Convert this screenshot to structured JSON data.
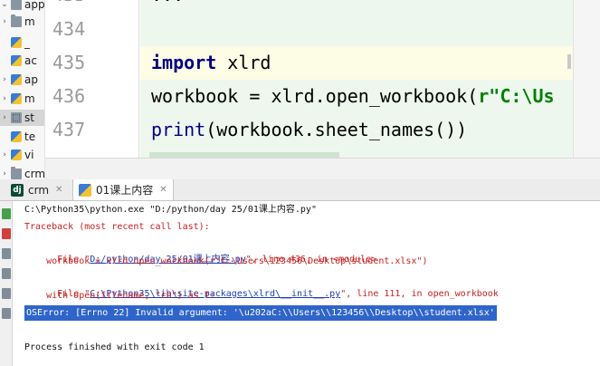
{
  "project_tree": {
    "items": [
      {
        "label": "app0",
        "icon": "folder-icon",
        "expanded": true
      },
      {
        "label": "m",
        "icon": "folder-icon",
        "expanded": false
      },
      {
        "label": "_",
        "icon": "python-file-icon"
      },
      {
        "label": "ac",
        "icon": "python-file-icon"
      },
      {
        "label": "ap",
        "icon": "python-file-icon"
      },
      {
        "label": "m",
        "icon": "python-file-icon"
      },
      {
        "label": "st",
        "icon": "package-icon",
        "selected": true
      },
      {
        "label": "te",
        "icon": "python-file-icon"
      },
      {
        "label": "vi",
        "icon": "python-file-icon"
      },
      {
        "label": "crm",
        "icon": "folder-icon"
      }
    ]
  },
  "editor": {
    "line_numbers": [
      "434",
      "435",
      "436",
      "437"
    ],
    "current_line": "435",
    "lines": [
      {
        "keyword": "import",
        "rest": " xlrd"
      },
      {
        "plain": "workbook = xlrd.open_workbook(",
        "string": "r\"C:\\Us"
      },
      {
        "builtin": "print",
        "rest": "(workbook.sheet_names())"
      }
    ]
  },
  "run_tabs": [
    {
      "label": "crm",
      "icon": "django-icon"
    },
    {
      "label": "01课上内容",
      "icon": "python-file-icon",
      "active": true
    }
  ],
  "console": {
    "command": "C:\\Python35\\python.exe \"D:/python/day 25/01课上内容.py\"",
    "traceback_header": "Traceback (most recent call last):",
    "frame1": {
      "prefix": "  File \"",
      "path": "D:/python/day 25/01课上内容.py",
      "suffix": "\", line 436, in <module>"
    },
    "frame1_code": "    workbook = xlrd.open_workbook(r\"C:\\Users\\123456\\Desktop\\student.xlsx\")",
    "frame2": {
      "prefix": "  File \"",
      "path": "C:\\Python35\\lib\\site-packages\\xlrd\\__init__.py",
      "suffix": "\", line 111, in open_workbook"
    },
    "frame2_code": "    with open(filename, \"rb\") as f:",
    "error": "OSError: [Errno 22] Invalid argument: '\\u202aC:\\\\Users\\\\123456\\\\Desktop\\\\student.xlsx'",
    "exit": "Process finished with exit code 1"
  },
  "colors": {
    "editor_bg": "#eef7ee",
    "current_line_bg": "#fdfce5",
    "keyword": "#000080",
    "string": "#008000",
    "error_text": "#c81e1e",
    "link": "#1a3fb5",
    "selection": "#2f65ca"
  }
}
